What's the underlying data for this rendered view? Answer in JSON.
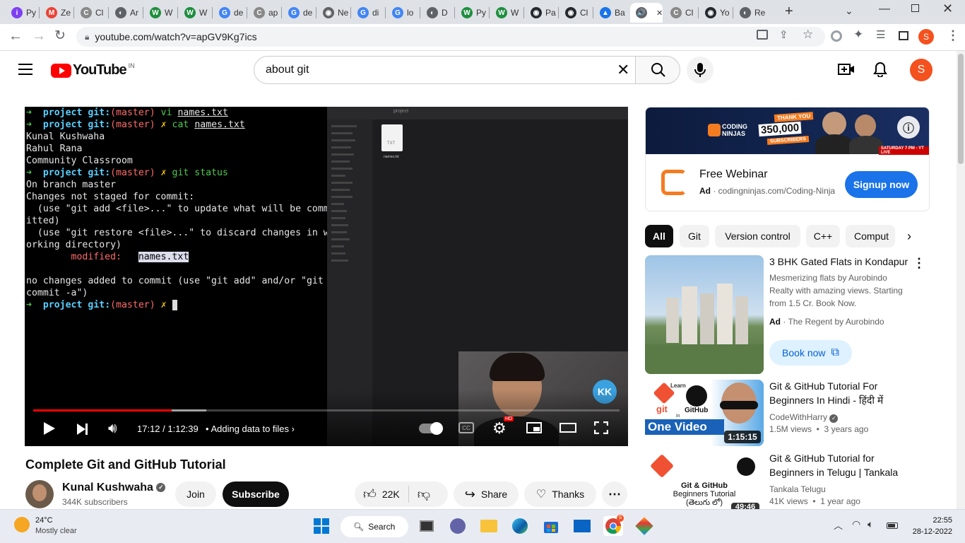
{
  "browser": {
    "tabs": [
      {
        "label": "Py",
        "color": "#7e3ff2",
        "glyph": "i"
      },
      {
        "label": "Ze",
        "color": "#ea4335",
        "glyph": "M"
      },
      {
        "label": "Cl",
        "color": "#888888",
        "glyph": "C"
      },
      {
        "label": "Ar",
        "color": "#5f6368",
        "glyph": "◐"
      },
      {
        "label": "W",
        "color": "#1e8e3e",
        "glyph": "W"
      },
      {
        "label": "W",
        "color": "#1e8e3e",
        "glyph": "W"
      },
      {
        "label": "de",
        "color": "#4285f4",
        "glyph": "G"
      },
      {
        "label": "ap",
        "color": "#888888",
        "glyph": "C"
      },
      {
        "label": "de",
        "color": "#4285f4",
        "glyph": "G"
      },
      {
        "label": "Ne",
        "color": "#5f6368",
        "glyph": "◉"
      },
      {
        "label": "di",
        "color": "#4285f4",
        "glyph": "G"
      },
      {
        "label": "lo",
        "color": "#4285f4",
        "glyph": "G"
      },
      {
        "label": "D",
        "color": "#5f6368",
        "glyph": "◐"
      },
      {
        "label": "Py",
        "color": "#1e8e3e",
        "glyph": "W"
      },
      {
        "label": "W",
        "color": "#1e8e3e",
        "glyph": "W"
      },
      {
        "label": "Pa",
        "color": "#24292f",
        "glyph": "◉"
      },
      {
        "label": "Cl",
        "color": "#24292f",
        "glyph": "◉"
      },
      {
        "label": "Ba",
        "color": "#1a73e8",
        "glyph": "▲"
      },
      {
        "label": "",
        "color": "#5f6368",
        "glyph": "🔊"
      },
      {
        "label": "Cl",
        "color": "#888888",
        "glyph": "C"
      },
      {
        "label": "Yo",
        "color": "#24292f",
        "glyph": "◉"
      },
      {
        "label": "Re",
        "color": "#5f6368",
        "glyph": "◐"
      }
    ],
    "url": "youtube.com/watch?v=apGV9Kg7ics",
    "profile_initial": "S"
  },
  "youtube": {
    "logo": "YouTube",
    "region": "IN",
    "search_value": "about git",
    "avatar_initial": "S"
  },
  "video": {
    "terminal_text": {
      "l1_path": "project",
      "l1_git": "git:",
      "l1_branch": "(master)",
      "l1_cmd": "vi",
      "l1_file": "names.txt",
      "l2_cmd": "cat",
      "l2_file": "names.txt",
      "out1": "Kunal Kushwaha",
      "out2": "Rahul Rana",
      "out3": "Community Classroom",
      "l3_cmd": "git status",
      "s1": "On branch master",
      "s2": "Changes not staged for commit:",
      "s3": "  (use \"git add <file>...\" to update what will be comm",
      "s4": "itted)",
      "s5": "  (use \"git restore <file>...\" to discard changes in w",
      "s6": "orking directory)",
      "mod_label": "modified:",
      "mod_file": "names.txt",
      "s7": "no changes added to commit (use \"git add\" and/or \"git",
      "s8": "commit -a\")"
    },
    "finder_title": "project",
    "finder_file": "names.txt",
    "finder_file_type": "TXT",
    "time": "17:12 / 1:12:39",
    "chapter": "Adding data to files",
    "progress_fraction": 0.2365,
    "buffered_fraction": 0.295,
    "hd_badge": "HD",
    "cc_label": "CC",
    "channel_watermark": "KK"
  },
  "title": "Complete Git and GitHub Tutorial",
  "channel": {
    "name": "Kunal Kushwaha",
    "subs": "344K subscribers"
  },
  "actions": {
    "join": "Join",
    "subscribe": "Subscribe",
    "likes": "22K",
    "share": "Share",
    "thanks": "Thanks"
  },
  "ad": {
    "banner_brand": "CODING NINJAS",
    "banner_text1": "THANK YOU",
    "banner_number": "350,000",
    "banner_text2": "SUBSCRIBERS",
    "banner_footer": "SATURDAY 7 PM - YT LIVE",
    "title": "Free Webinar",
    "ad_label": "Ad",
    "domain": "codingninjas.com/Coding-Ninja",
    "cta": "Signup now"
  },
  "chips": [
    "All",
    "Git",
    "Version control",
    "C++",
    "Comput"
  ],
  "recommendations": [
    {
      "title": "3 BHK Gated Flats in Kondapur",
      "desc": "Mesmerizing flats by Aurobindo Realty with amazing views. Starting from 1.5 Cr. Book Now.",
      "ad_label": "Ad",
      "advertiser": "The Regent by Aurobindo",
      "cta": "Book now"
    },
    {
      "title": "Git & GitHub Tutorial For Beginners In Hindi - हिंदी में",
      "channel": "CodeWithHarry",
      "meta": "1.5M views  •  3 years ago",
      "duration": "1:15:15",
      "thumb_text1": "Learn",
      "thumb_text2": "GitHub",
      "thumb_text3": "in",
      "thumb_text4": "One Video",
      "thumb_git": "git"
    },
    {
      "title": "Git & GitHub Tutorial for Beginners in Telugu | Tankala",
      "channel": "Tankala Telugu",
      "meta": "41K views  •  1 year ago",
      "duration": "49:46",
      "thumb_text1": "Git & GitHub",
      "thumb_text2": "Beginners Tutorial",
      "thumb_text3": "(తెలుగు లో)"
    }
  ],
  "taskbar": {
    "temp": "24°C",
    "weather": "Mostly clear",
    "search_label": "Search",
    "time": "22:55",
    "date": "28-12-2022"
  },
  "colors": {
    "yt_red": "#ff0000",
    "accent_blue": "#065fd4",
    "cta_blue": "#1a73e8",
    "avatar_orange": "#f4511e"
  }
}
